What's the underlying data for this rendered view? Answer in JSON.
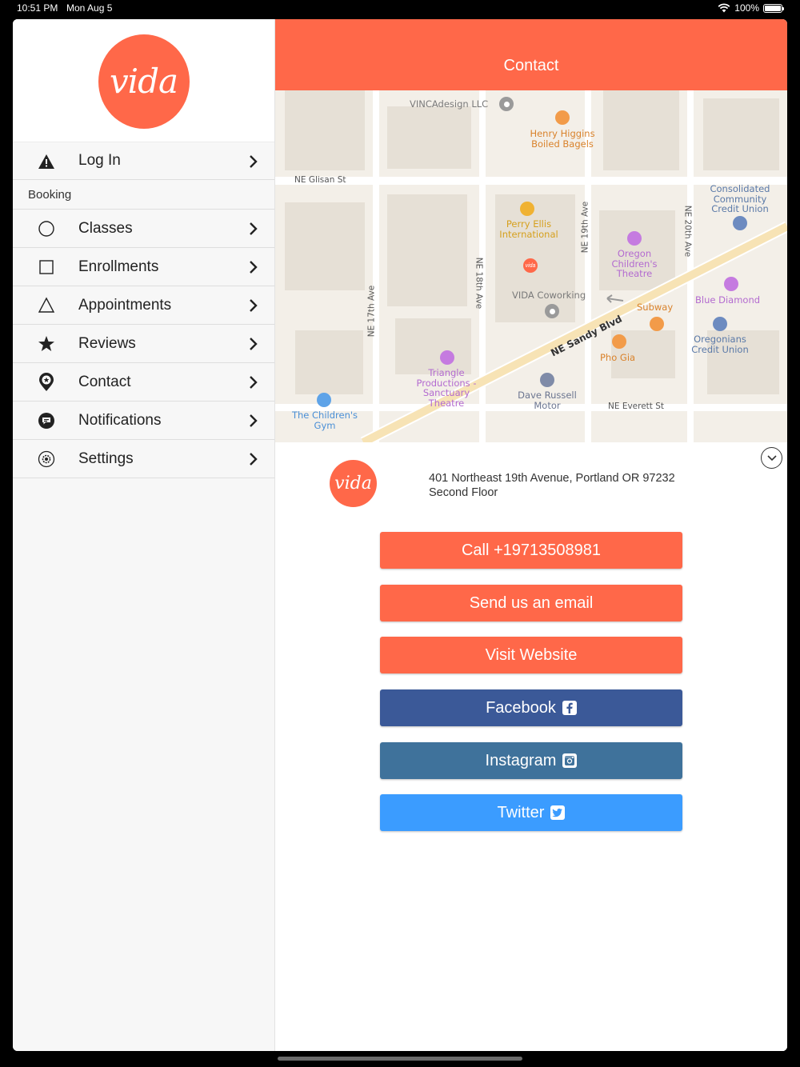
{
  "status_bar": {
    "time": "10:51 PM",
    "date": "Mon Aug 5",
    "battery": "100%"
  },
  "colors": {
    "brand": "#ff6849",
    "facebook": "#3b5998",
    "instagram": "#3f729b",
    "twitter": "#3b9cff"
  },
  "sidebar": {
    "logo_text": "vida",
    "login": {
      "label": "Log In",
      "icon": "warning-icon"
    },
    "section_title": "Booking",
    "items": [
      {
        "label": "Classes",
        "icon": "circle-icon"
      },
      {
        "label": "Enrollments",
        "icon": "square-icon"
      },
      {
        "label": "Appointments",
        "icon": "triangle-icon"
      },
      {
        "label": "Reviews",
        "icon": "star-icon"
      },
      {
        "label": "Contact",
        "icon": "map-pin-icon"
      },
      {
        "label": "Notifications",
        "icon": "chat-bubble-icon"
      },
      {
        "label": "Settings",
        "icon": "gear-icon"
      }
    ]
  },
  "header": {
    "title": "Contact"
  },
  "map": {
    "streets": [
      "NE Glisan St",
      "NE 17th Ave",
      "NE 18th Ave",
      "NE 19th Ave",
      "NE 20th Ave",
      "NE Sandy Blvd",
      "NE Everett St"
    ],
    "places": [
      "VINCAdesign LLC",
      "Henry Higgins Boiled Bagels",
      "Perry Ellis International",
      "Oregon Children's Theatre",
      "Consolidated Community Credit Union",
      "VIDA Coworking",
      "Subway",
      "Blue Diamond",
      "Pho Gia",
      "Oregonians Credit Union",
      "Triangle Productions - Sanctuary Theatre",
      "Dave Russell Motor",
      "The Children's Gym"
    ]
  },
  "contact": {
    "logo_text": "vida",
    "address_line1": "401 Northeast 19th Avenue, Portland OR 97232",
    "address_line2": "Second Floor",
    "call_label": "Call +19713508981",
    "email_label": "Send us an email",
    "website_label": "Visit Website",
    "facebook_label": "Facebook",
    "instagram_label": "Instagram",
    "twitter_label": "Twitter"
  }
}
